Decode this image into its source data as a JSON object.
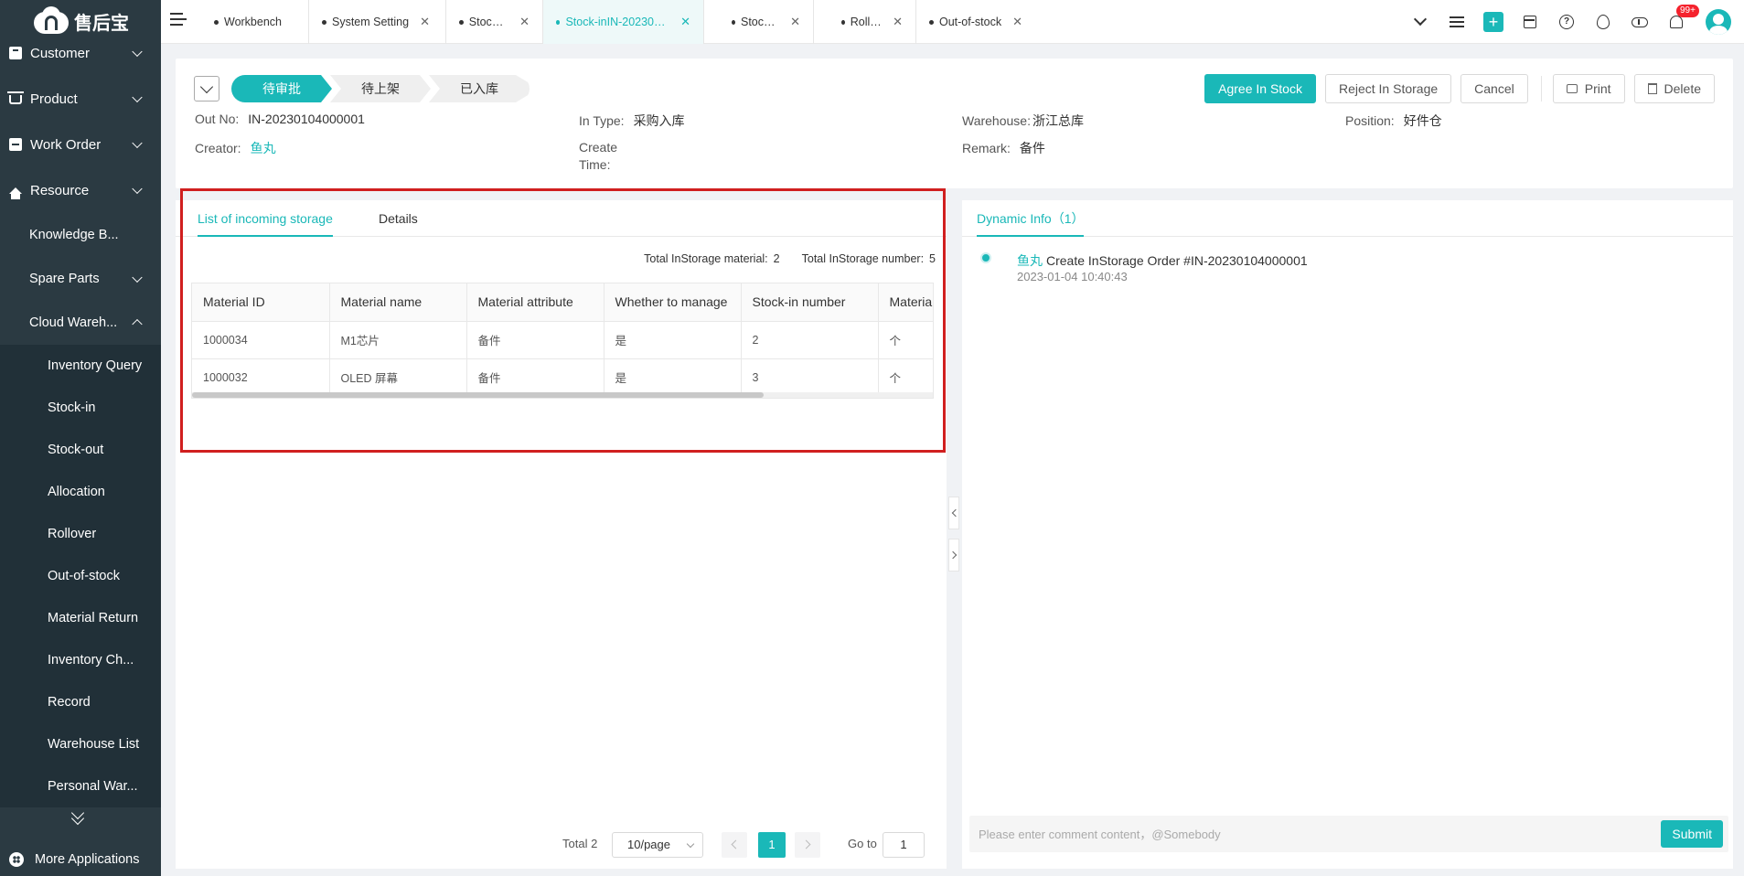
{
  "app": {
    "logo_text": "售后宝"
  },
  "sidebar": {
    "top_items": [
      {
        "label": "Customer"
      },
      {
        "label": "Product"
      },
      {
        "label": "Work Order"
      },
      {
        "label": "Resource"
      }
    ],
    "sub_items": [
      {
        "label": "Knowledge B..."
      },
      {
        "label": "Spare Parts"
      },
      {
        "label": "Cloud Wareh..."
      }
    ],
    "leaf_items": [
      {
        "label": "Inventory Query"
      },
      {
        "label": "Stock-in"
      },
      {
        "label": "Stock-out"
      },
      {
        "label": "Allocation"
      },
      {
        "label": "Rollover"
      },
      {
        "label": "Out-of-stock"
      },
      {
        "label": "Material Return"
      },
      {
        "label": "Inventory Ch..."
      },
      {
        "label": "Record"
      },
      {
        "label": "Warehouse List"
      },
      {
        "label": "Personal War..."
      }
    ],
    "more_apps": "More Applications"
  },
  "tabs": [
    {
      "label": "Workbench",
      "closable": false
    },
    {
      "label": "System Setting",
      "closable": true
    },
    {
      "label": "Stock-in",
      "closable": true
    },
    {
      "label": "Stock-inIN-20230104...",
      "closable": true,
      "active": true
    },
    {
      "label": "Stock-out",
      "closable": true
    },
    {
      "label": "Rollover",
      "closable": true
    },
    {
      "label": "Out-of-stock",
      "closable": true
    }
  ],
  "topbar": {
    "notification_badge": "99+",
    "plus": "+",
    "help": "?"
  },
  "steps": [
    "待审批",
    "待上架",
    "已入库"
  ],
  "actions": {
    "agree": "Agree In Stock",
    "reject": "Reject In Storage",
    "cancel": "Cancel",
    "print": "Print",
    "delete": "Delete"
  },
  "info": {
    "out_no_label": "Out No:",
    "out_no": "IN-20230104000001",
    "in_type_label": "In Type:",
    "in_type": "采购入库",
    "warehouse_label": "Warehouse:",
    "warehouse": "浙江总库",
    "position_label": "Position:",
    "position": "好件仓",
    "creator_label": "Creator:",
    "creator": "鱼丸",
    "create_time_label_1": "Create",
    "create_time_label_2": "Time:",
    "remark_label": "Remark:",
    "remark": "备件"
  },
  "left_panel": {
    "tabs": [
      "List of incoming storage",
      "Details"
    ],
    "totals": {
      "material_label": "Total InStorage material:",
      "material": "2",
      "number_label": "Total InStorage number:",
      "number": "5"
    },
    "columns": [
      "Material ID",
      "Material name",
      "Material attribute",
      "Whether to manage",
      "Stock-in number",
      "Materia"
    ],
    "rows": [
      [
        "1000034",
        "M1芯片",
        "备件",
        "是",
        "2",
        "个"
      ],
      [
        "1000032",
        "OLED 屏幕",
        "备件",
        "是",
        "3",
        "个"
      ]
    ]
  },
  "pagination": {
    "total": "Total 2",
    "page_size": "10/page",
    "current": "1",
    "goto_label": "Go to",
    "goto_value": "1"
  },
  "right_panel": {
    "tab": "Dynamic Info（1）",
    "events": [
      {
        "who": "鱼丸",
        "text": "Create InStorage Order #IN-20230104000001",
        "time": "2023-01-04 10:40:43"
      }
    ],
    "comment_placeholder": "Please enter comment content，@Somebody",
    "submit": "Submit"
  }
}
